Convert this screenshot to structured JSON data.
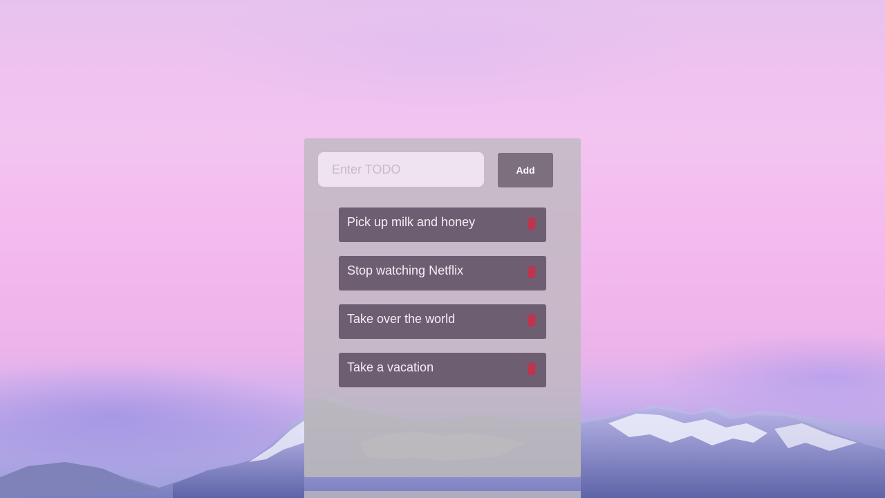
{
  "form": {
    "input_placeholder": "Enter TODO",
    "input_value": "",
    "add_label": "Add"
  },
  "todos": [
    {
      "text": "Pick up milk and honey"
    },
    {
      "text": "Stop watching Netflix"
    },
    {
      "text": "Take over the world"
    },
    {
      "text": "Take a vacation"
    }
  ],
  "icons": {
    "delete": "trash-icon",
    "add": "none"
  },
  "colors": {
    "panel": "#bcb8be",
    "item_background": "#645467",
    "add_button": "#7c6f7e",
    "delete_icon": "#c4314b",
    "item_text": "#f5eef6"
  }
}
